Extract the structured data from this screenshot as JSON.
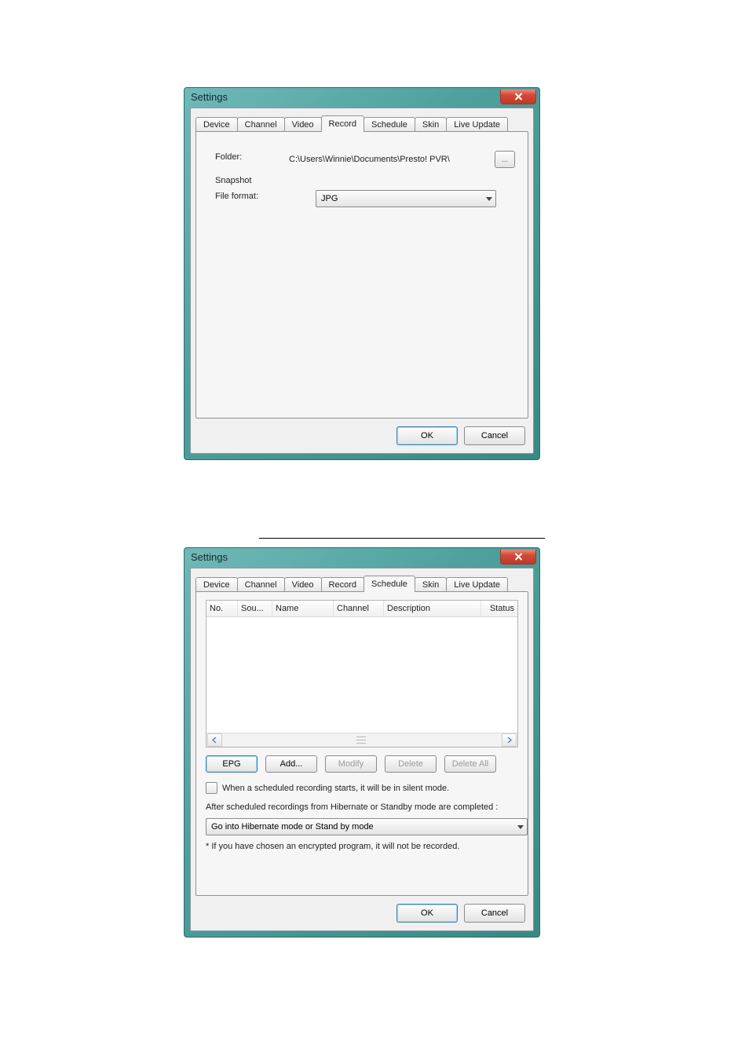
{
  "dialogs": {
    "record": {
      "title": "Settings",
      "tabs": [
        "Device",
        "Channel",
        "Video",
        "Record",
        "Schedule",
        "Skin",
        "Live Update"
      ],
      "active_tab": "Record",
      "folder_label": "Folder:",
      "folder_value": "C:\\Users\\Winnie\\Documents\\Presto! PVR\\",
      "browse_label": "...",
      "snapshot_label": "Snapshot",
      "fileformat_label": "File format:",
      "fileformat_value": "JPG",
      "ok": "OK",
      "cancel": "Cancel"
    },
    "schedule": {
      "title": "Settings",
      "tabs": [
        "Device",
        "Channel",
        "Video",
        "Record",
        "Schedule",
        "Skin",
        "Live Update"
      ],
      "active_tab": "Schedule",
      "columns": [
        "No.",
        "Sou...",
        "Name",
        "Channel",
        "Description",
        "Status"
      ],
      "buttons": {
        "epg": "EPG",
        "add": "Add...",
        "modify": "Modify",
        "delete": "Delete",
        "delete_all": "Delete All"
      },
      "silent_checkbox_label": "When a scheduled recording starts, it will be in silent mode.",
      "after_label": "After scheduled recordings from Hibernate or Standby mode are completed :",
      "after_value": "Go into Hibernate mode or Stand by mode",
      "note": "* If you have chosen an encrypted program, it will not be recorded.",
      "ok": "OK",
      "cancel": "Cancel"
    }
  }
}
